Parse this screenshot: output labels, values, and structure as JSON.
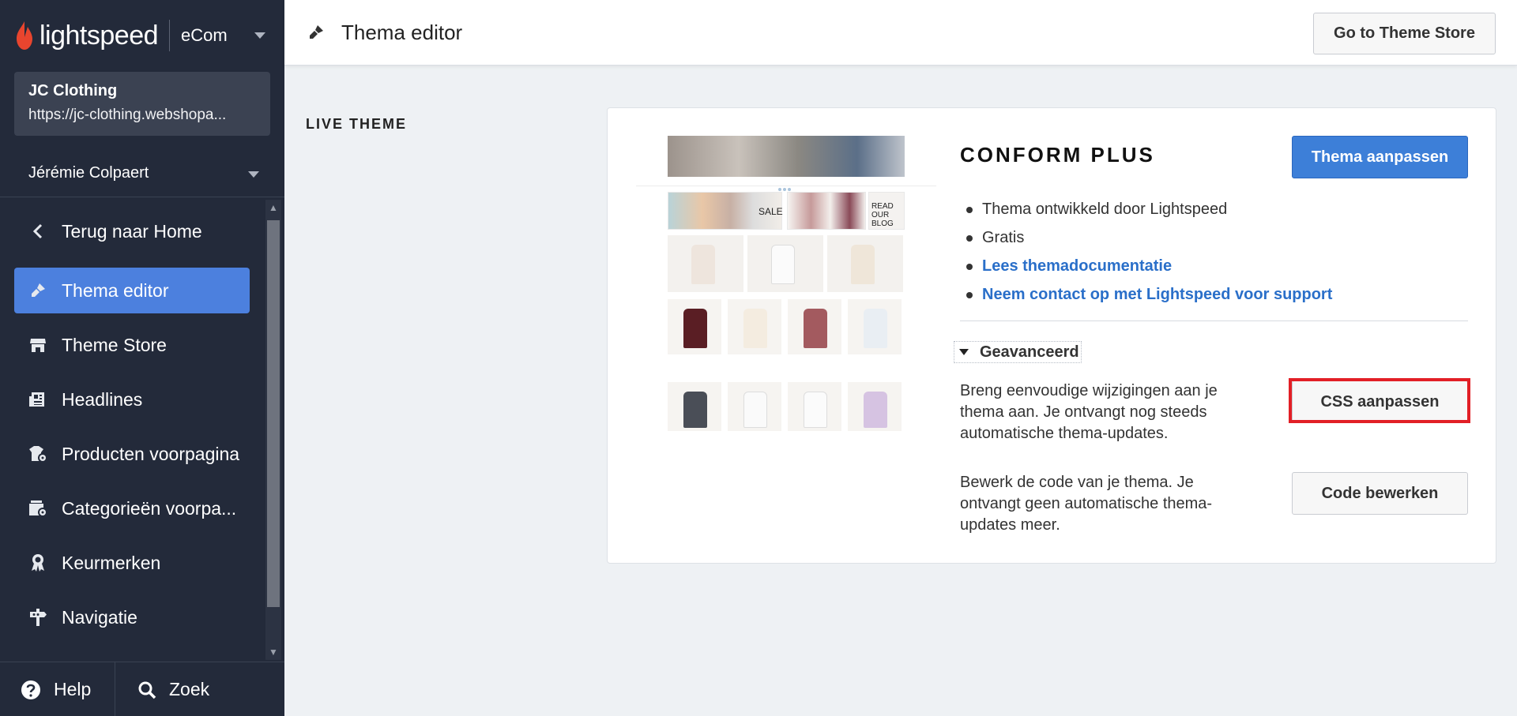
{
  "brand": {
    "logo_text": "lightspeed",
    "product": "eCom",
    "accent": "#e8452e"
  },
  "shop": {
    "name": "JC Clothing",
    "url": "https://jc-clothing.webshopa..."
  },
  "user": {
    "name": "Jérémie Colpaert"
  },
  "nav": {
    "items": [
      {
        "label": "Terug naar Home",
        "icon": "chevron-left-icon"
      },
      {
        "label": "Thema editor",
        "icon": "paintbrush-icon",
        "active": true
      },
      {
        "label": "Theme Store",
        "icon": "store-icon"
      },
      {
        "label": "Headlines",
        "icon": "newspaper-icon"
      },
      {
        "label": "Producten voorpagina",
        "icon": "products-settings-icon"
      },
      {
        "label": "Categorieën voorpa...",
        "icon": "categories-settings-icon"
      },
      {
        "label": "Keurmerken",
        "icon": "badge-icon"
      },
      {
        "label": "Navigatie",
        "icon": "signpost-icon"
      }
    ]
  },
  "bottom": {
    "help": "Help",
    "search": "Zoek"
  },
  "topbar": {
    "title": "Thema editor",
    "store_button": "Go to Theme Store"
  },
  "main": {
    "section_label": "LIVE THEME",
    "theme": {
      "name": "CONFORM PLUS",
      "customize_button": "Thema aanpassen",
      "bullets": [
        {
          "text": "Thema ontwikkeld door Lightspeed",
          "link": false
        },
        {
          "text": "Gratis",
          "link": false
        },
        {
          "text": "Lees themadocumentatie",
          "link": true
        },
        {
          "text": "Neem contact op met Lightspeed voor support",
          "link": true
        }
      ],
      "advanced_label": "Geavanceerd",
      "css_desc": "Breng eenvoudige wijzigingen aan je thema aan. Je ontvangt nog steeds automatische thema-updates.",
      "css_button": "CSS aanpassen",
      "code_desc": "Bewerk de code van je thema. Je ontvangt geen automatische thema-updates meer.",
      "code_button": "Code bewerken",
      "preview": {
        "sale_text": "SALE",
        "blog_text": "READ OUR BLOG"
      }
    }
  },
  "colors": {
    "sidebar_bg": "#232a3a",
    "active_nav": "#4c80de",
    "primary_button": "#3d7fd8",
    "link": "#2a6fc9",
    "highlight_box": "#e21f26"
  }
}
